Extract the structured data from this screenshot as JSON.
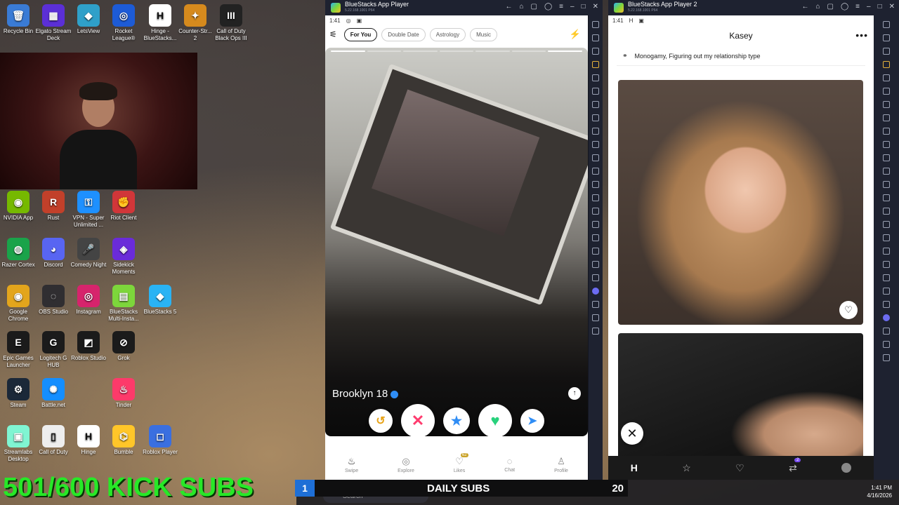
{
  "desktop": {
    "icons": [
      {
        "label": "Recycle Bin",
        "icon": "recycle-bin-icon",
        "color": "#3a7bd5",
        "glyph": "🗑",
        "col": 0,
        "row": 0
      },
      {
        "label": "Elgato Stream Deck",
        "icon": "stream-deck-icon",
        "color": "#5b2fd6",
        "glyph": "▦",
        "col": 1,
        "row": 0
      },
      {
        "label": "LetsView",
        "icon": "letsview-icon",
        "color": "#2fa0c9",
        "glyph": "◆",
        "col": 2,
        "row": 0
      },
      {
        "label": "Rocket League®",
        "icon": "rocket-league-icon",
        "color": "#1d5bd6",
        "glyph": "◎",
        "col": 3,
        "row": 0
      },
      {
        "label": "Hinge - BlueStacks...",
        "icon": "hinge-icon",
        "color": "#ffffff",
        "glyph": "H",
        "col": 4,
        "row": 0
      },
      {
        "label": "Counter-Str... 2",
        "icon": "counter-strike-icon",
        "color": "#d68a1d",
        "glyph": "✦",
        "col": 5,
        "row": 0
      },
      {
        "label": "Call of Duty Black Ops III",
        "icon": "black-ops-icon",
        "color": "#222222",
        "glyph": "III",
        "col": 6,
        "row": 0
      },
      {
        "label": "NVIDIA App",
        "icon": "nvidia-icon",
        "color": "#76b900",
        "glyph": "◉",
        "col": 0,
        "row": 4
      },
      {
        "label": "Rust",
        "icon": "rust-icon",
        "color": "#c2402a",
        "glyph": "R",
        "col": 1,
        "row": 4
      },
      {
        "label": "VPN - Super Unlimited ...",
        "icon": "vpn-icon",
        "color": "#1e90ff",
        "glyph": "⚿",
        "col": 2,
        "row": 4
      },
      {
        "label": "Riot Client",
        "icon": "riot-client-icon",
        "color": "#d13639",
        "glyph": "✊",
        "col": 3,
        "row": 4
      },
      {
        "label": "Razer Cortex",
        "icon": "razer-cortex-icon",
        "color": "#1aa34a",
        "glyph": "◍",
        "col": 0,
        "row": 5
      },
      {
        "label": "Discord",
        "icon": "discord-icon",
        "color": "#5865f2",
        "glyph": "◕",
        "col": 1,
        "row": 5
      },
      {
        "label": "Comedy Night",
        "icon": "comedy-night-icon",
        "color": "#444444",
        "glyph": "🎤",
        "col": 2,
        "row": 5
      },
      {
        "label": "Sidekick Moments",
        "icon": "sidekick-icon",
        "color": "#6a2bd9",
        "glyph": "◈",
        "col": 3,
        "row": 5
      },
      {
        "label": "Google Chrome",
        "icon": "chrome-icon",
        "color": "#e3a51c",
        "glyph": "◉",
        "col": 0,
        "row": 6
      },
      {
        "label": "OBS Studio",
        "icon": "obs-icon",
        "color": "#302e31",
        "glyph": "◌",
        "col": 1,
        "row": 6
      },
      {
        "label": "Instagram",
        "icon": "instagram-icon",
        "color": "#d6246c",
        "glyph": "◎",
        "col": 2,
        "row": 6
      },
      {
        "label": "BlueStacks Multi-Insta...",
        "icon": "bluestacks-multi-icon",
        "color": "#7dd63b",
        "glyph": "▤",
        "col": 3,
        "row": 6
      },
      {
        "label": "BlueStacks 5",
        "icon": "bluestacks-icon",
        "color": "#2ab3f4",
        "glyph": "◆",
        "col": 4,
        "row": 6
      },
      {
        "label": "Epic Games Launcher",
        "icon": "epic-games-icon",
        "color": "#1b1b1b",
        "glyph": "E",
        "col": 0,
        "row": 7
      },
      {
        "label": "Logitech G HUB",
        "icon": "logitech-icon",
        "color": "#1b1b1b",
        "glyph": "G",
        "col": 1,
        "row": 7
      },
      {
        "label": "Roblox Studio",
        "icon": "roblox-studio-icon",
        "color": "#1b1b1b",
        "glyph": "◩",
        "col": 2,
        "row": 7
      },
      {
        "label": "Grok",
        "icon": "grok-icon",
        "color": "#1b1b1b",
        "glyph": "⊘",
        "col": 3,
        "row": 7
      },
      {
        "label": "Steam",
        "icon": "steam-icon",
        "color": "#1b2838",
        "glyph": "⚙",
        "col": 0,
        "row": 8
      },
      {
        "label": "Battle.net",
        "icon": "battlenet-icon",
        "color": "#148eff",
        "glyph": "✺",
        "col": 1,
        "row": 8
      },
      {
        "label": "Tinder",
        "icon": "tinder-icon",
        "color": "#fd3a6a",
        "glyph": "♨",
        "col": 3,
        "row": 8
      },
      {
        "label": "Streamlabs Desktop",
        "icon": "streamlabs-icon",
        "color": "#80f5d2",
        "glyph": "▣",
        "col": 0,
        "row": 9
      },
      {
        "label": "Call of Duty",
        "icon": "file-icon",
        "color": "#eeeeee",
        "glyph": "▯",
        "col": 1,
        "row": 9
      },
      {
        "label": "Hinge",
        "icon": "hinge-icon",
        "color": "#ffffff",
        "glyph": "H",
        "col": 2,
        "row": 9
      },
      {
        "label": "Bumble",
        "icon": "bumble-icon",
        "color": "#ffc629",
        "glyph": "⌬",
        "col": 3,
        "row": 9
      },
      {
        "label": "Roblox Player",
        "icon": "roblox-icon",
        "color": "#3a6fe0",
        "glyph": "◻",
        "col": 4,
        "row": 9
      }
    ]
  },
  "overlay": {
    "kick_subs": "501/600 KICK SUBS",
    "daily_subs_label": "DAILY SUBS",
    "daily_rank": "1",
    "daily_count": "20"
  },
  "window1": {
    "title": "BlueStacks App Player",
    "subtitle": "5.22.168.1001 P64",
    "status_time": "1:41",
    "chips": [
      "For You",
      "Double Date",
      "Astrology",
      "Music"
    ],
    "profile_name": "Brooklyn 18",
    "nav": [
      {
        "label": "Swipe",
        "icon": "flame-icon"
      },
      {
        "label": "Explore",
        "icon": "compass-icon"
      },
      {
        "label": "Likes",
        "icon": "heart-icon",
        "badge": "62"
      },
      {
        "label": "Chat",
        "icon": "chat-icon"
      },
      {
        "label": "Profile",
        "icon": "profile-icon"
      }
    ]
  },
  "window2": {
    "title": "BlueStacks App Player 2",
    "subtitle": "5.22.168.1001 P64",
    "status_time": "1:41",
    "profile_name": "Kasey",
    "relationship": "Monogamy, Figuring out my relationship type",
    "nav_badge": "2"
  },
  "taskbar": {
    "search_placeholder": "Search",
    "time": "1:41 PM",
    "date": "4/16/2026"
  }
}
